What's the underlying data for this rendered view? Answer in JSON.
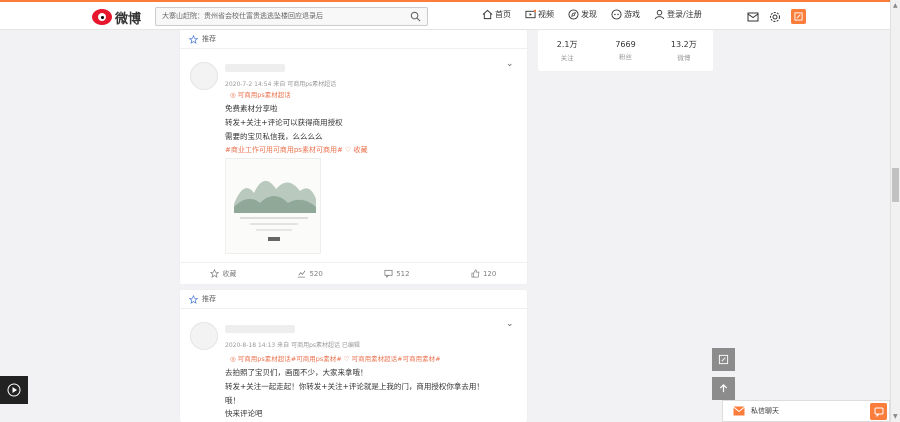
{
  "header": {
    "logo_text": "微博",
    "search_placeholder": "大寨山赶院：贵州省会校仕富贵逃逃坠楼回应退录后",
    "nav": [
      {
        "icon": "home-icon",
        "label": "首页"
      },
      {
        "icon": "video-icon",
        "label": "视频"
      },
      {
        "icon": "discover-icon",
        "label": "发现"
      },
      {
        "icon": "game-icon",
        "label": "游戏"
      },
      {
        "icon": "user-icon",
        "label": "登录/注册"
      }
    ],
    "accent": "#fa7d3c"
  },
  "stats": [
    {
      "value": "2.1万",
      "label": "关注"
    },
    {
      "value": "7669",
      "label": "粉丝"
    },
    {
      "value": "13.2万",
      "label": "微博"
    }
  ],
  "post1": {
    "section_label": "推荐",
    "meta": "2020-7-2 14:54  来自 可商用ps素材超话",
    "topic_tag": "可商用ps素材超话",
    "lines": [
      "免费素材分享啦",
      "转发+关注+评论可以获得商用授权",
      "需要的宝贝私信我，么么么么"
    ],
    "links_line": "#商业工作可用可商用ps素材可商用#  ♡ 收藏",
    "actions": {
      "forward": "收藏",
      "repost": "520",
      "comment": "512",
      "like": "120"
    }
  },
  "post2": {
    "section_label": "推荐",
    "meta": "2020-8-18 14:13  来自 可商用ps素材超话  已编辑",
    "topic_tag": "可商用ps素材超话#可商用ps素材#  ♡ 可商用素材超话#可商用素材#",
    "lines": [
      "去拍照了宝贝们，画面不少，大家来拿哦！",
      "转发+关注一起走起！你转发+关注+评论就是上我的门，商用授权你拿去用！",
      "哦！",
      "快来评论吧"
    ]
  },
  "chat": {
    "label": "私信聊天"
  }
}
